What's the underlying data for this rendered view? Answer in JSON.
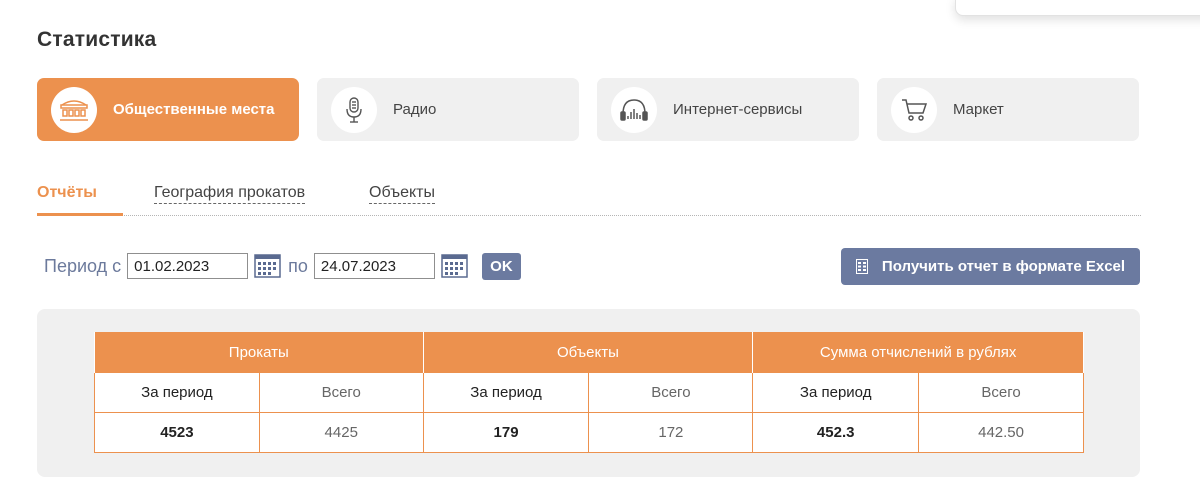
{
  "page": {
    "title": "Статистика"
  },
  "categories": [
    {
      "label": "Общественные места",
      "icon": "building-icon",
      "active": true
    },
    {
      "label": "Радио",
      "icon": "microphone-icon",
      "active": false
    },
    {
      "label": "Интернет-сервисы",
      "icon": "headphones-icon",
      "active": false
    },
    {
      "label": "Маркет",
      "icon": "cart-icon",
      "active": false
    }
  ],
  "tabs": [
    {
      "label": "Отчёты",
      "active": true
    },
    {
      "label": "География прокатов",
      "active": false
    },
    {
      "label": "Объекты",
      "active": false
    }
  ],
  "period": {
    "from_label": "Период с",
    "to_label": "по",
    "from_value": "01.02.2023",
    "to_value": "24.07.2023",
    "ok_label": "OK"
  },
  "excel_button": {
    "label": "Получить отчет в формате Excel"
  },
  "table": {
    "groups": [
      "Прокаты",
      "Объекты",
      "Сумма отчислений в рублях"
    ],
    "subheaders": [
      "За период",
      "Всего",
      "За период",
      "Всего",
      "За период",
      "Всего"
    ],
    "values": [
      "4523",
      "4425",
      "179",
      "172",
      "452.3",
      "442.50"
    ]
  },
  "colors": {
    "accent": "#ec914e",
    "button": "#6b7aa0",
    "panel": "#f0f0f0",
    "period_text": "#6c7a9c"
  }
}
